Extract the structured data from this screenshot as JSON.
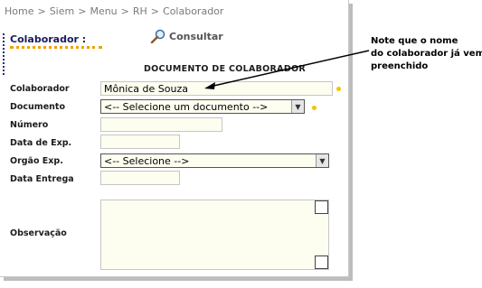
{
  "breadcrumb": {
    "items": [
      "Home",
      "Siem",
      "Menu",
      "RH",
      "Colaborador"
    ],
    "separator": ">"
  },
  "page_title": "Colaborador :",
  "consultar_label": "Consultar",
  "form": {
    "heading": "DOCUMENTO DE COLABORADOR",
    "colaborador": {
      "label": "Colaborador",
      "value": "Mônica de Souza"
    },
    "documento": {
      "label": "Documento",
      "selected": "<-- Selecione um documento -->"
    },
    "numero": {
      "label": "Número",
      "value": ""
    },
    "data_exp": {
      "label": "Data de Exp.",
      "value": ""
    },
    "orgao_exp": {
      "label": "Orgão Exp.",
      "selected": "<-- Selecione -->"
    },
    "data_entrega": {
      "label": "Data Entrega",
      "value": ""
    },
    "observacao": {
      "label": "Observação",
      "value": ""
    }
  },
  "annotation": {
    "line1": "Note que o nome",
    "line2": "do colaborador já vem",
    "line3": "preenchido"
  },
  "colors": {
    "title": "#1a1a5e",
    "required_dot": "#f2c400",
    "underline": "#f0a000"
  }
}
